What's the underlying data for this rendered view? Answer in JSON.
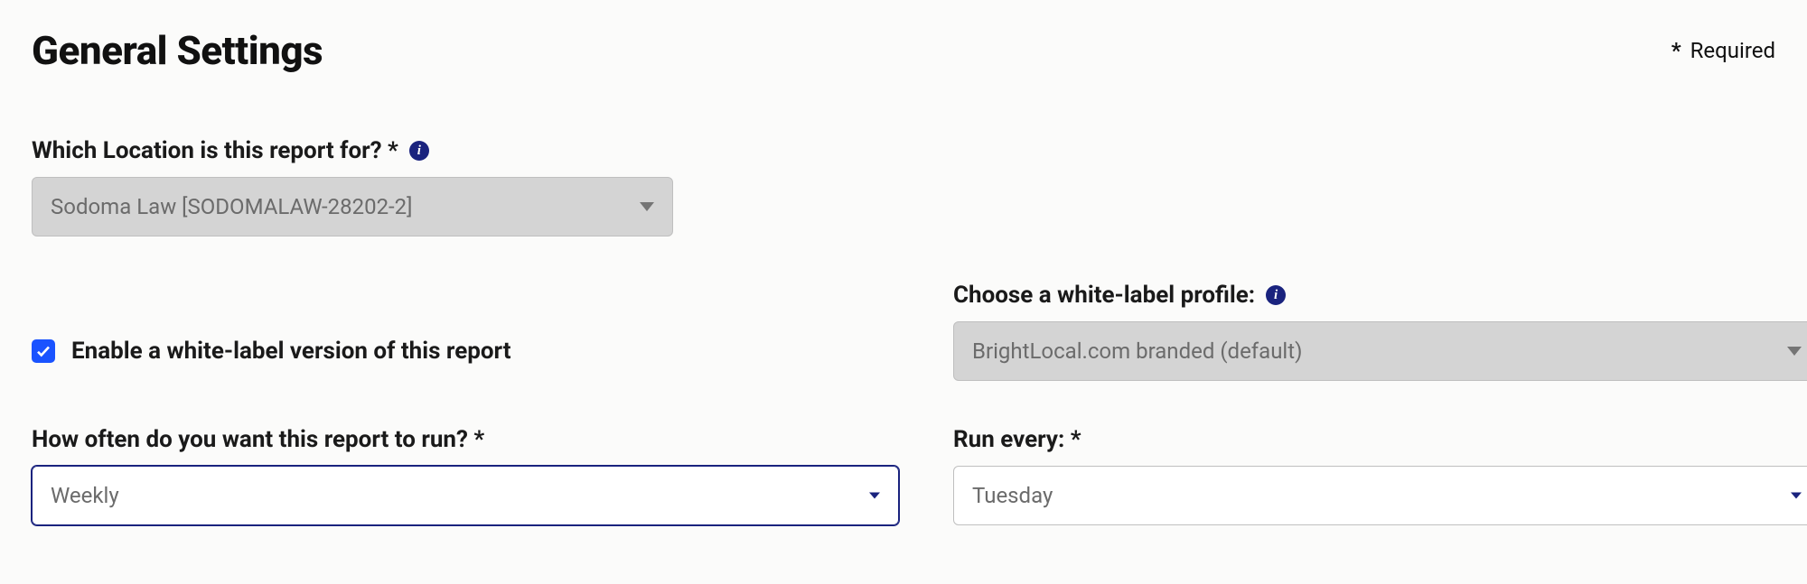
{
  "header": {
    "title": "General Settings",
    "required_hint": "Required"
  },
  "location": {
    "label": "Which Location is this report for? *",
    "value": "Sodoma Law [SODOMALAW-28202-2]"
  },
  "white_label_checkbox": {
    "label": "Enable a white-label version of this report",
    "checked": true
  },
  "white_label_profile": {
    "label": "Choose a white-label profile:",
    "value": "BrightLocal.com branded (default)"
  },
  "frequency": {
    "label": "How often do you want this report to run? *",
    "value": "Weekly"
  },
  "run_every": {
    "label": "Run every: *",
    "value": "Tuesday"
  }
}
